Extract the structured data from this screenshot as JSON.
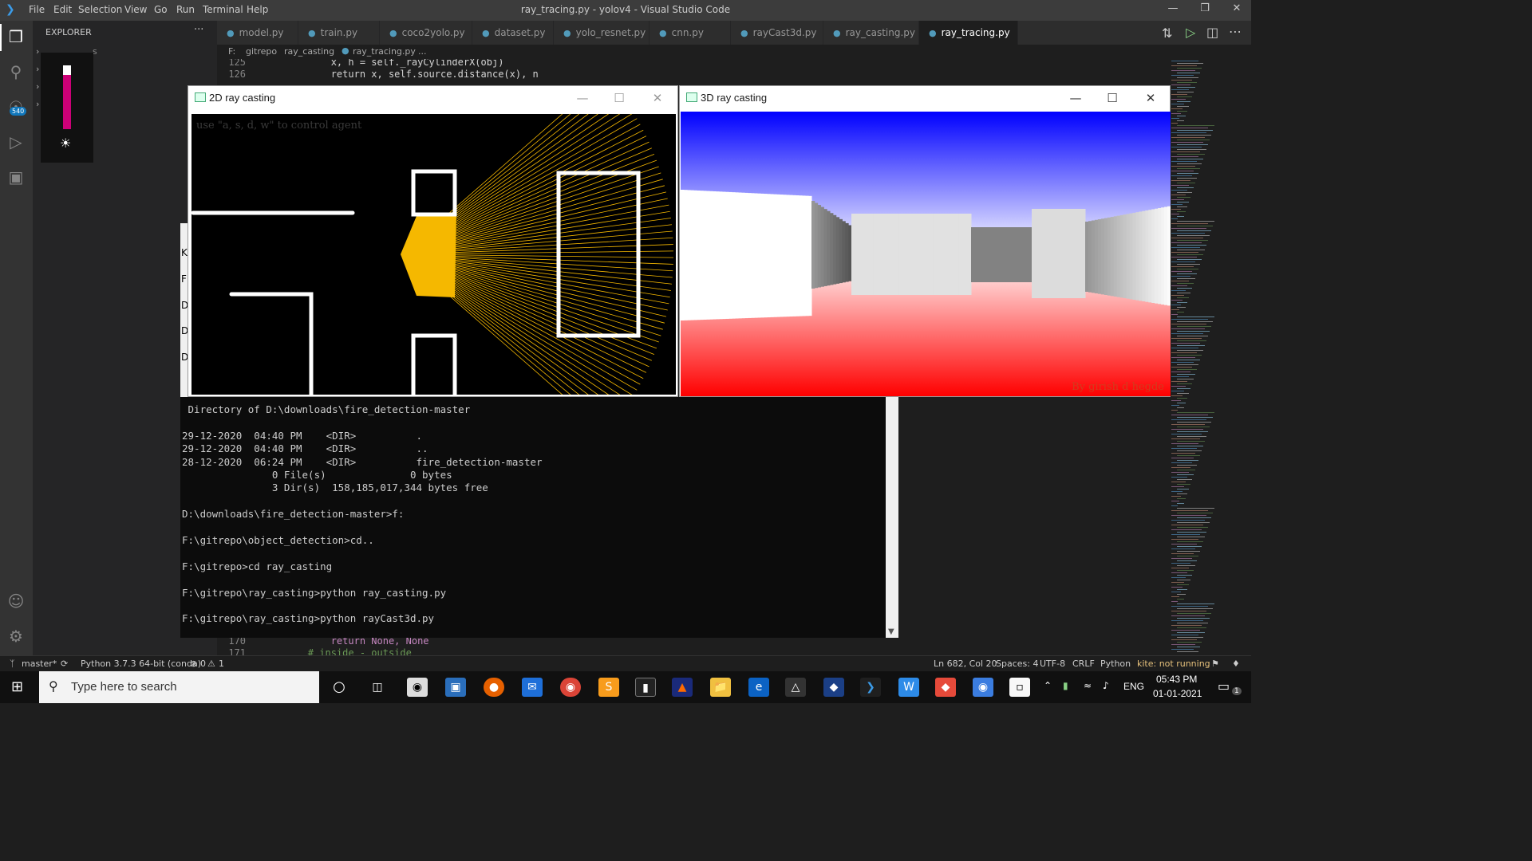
{
  "window": {
    "title": "ray_tracing.py - yolov4 - Visual Studio Code",
    "menu": [
      "File",
      "Edit",
      "Selection",
      "View",
      "Go",
      "Run",
      "Terminal",
      "Help"
    ]
  },
  "activity": {
    "badge": "540"
  },
  "sidebar": {
    "title": "EXPLORER",
    "more": "···",
    "fragment": "s"
  },
  "tabs": [
    {
      "label": "model.py"
    },
    {
      "label": "train.py"
    },
    {
      "label": "coco2yolo.py"
    },
    {
      "label": "dataset.py"
    },
    {
      "label": "yolo_resnet.py"
    },
    {
      "label": "cnn.py"
    },
    {
      "label": "rayCast3d.py"
    },
    {
      "label": "ray_casting.py"
    },
    {
      "label": "ray_tracing.py",
      "active": true
    }
  ],
  "breadcrumb": [
    "F:",
    "gitrepo",
    "ray_casting",
    "ray_tracing.py",
    "..."
  ],
  "code_top": [
    {
      "ln": "125",
      "text": "            x, h = self._rayCylinderX(obj)"
    },
    {
      "ln": "126",
      "text": "            return x, self.source.distance(x), n"
    }
  ],
  "code_bottom": [
    {
      "ln": "170",
      "text": "            return None, None"
    },
    {
      "ln": "171",
      "text": "        # inside - outside"
    }
  ],
  "win2d": {
    "title": "2D ray casting",
    "hint": "use \"a, s, d, w\" to control agent"
  },
  "win3d": {
    "title": "3D ray casting",
    "credit": "By girish d hegde"
  },
  "behind_letters": [
    "K",
    "F",
    "D",
    "D",
    "D"
  ],
  "console": [
    " Directory of D:\\downloads\\fire_detection-master",
    "",
    "29-12-2020  04:40 PM    <DIR>          .",
    "29-12-2020  04:40 PM    <DIR>          ..",
    "28-12-2020  06:24 PM    <DIR>          fire_detection-master",
    "               0 File(s)              0 bytes",
    "               3 Dir(s)  158,185,017,344 bytes free",
    "",
    "D:\\downloads\\fire_detection-master>f:",
    "",
    "F:\\gitrepo\\object_detection>cd..",
    "",
    "F:\\gitrepo>cd ray_casting",
    "",
    "F:\\gitrepo\\ray_casting>python ray_casting.py",
    "",
    "F:\\gitrepo\\ray_casting>python rayCast3d.py"
  ],
  "status": {
    "branch": "master*",
    "python": "Python 3.7.3 64-bit (conda)",
    "errors": "0",
    "warnings": "1",
    "position": "Ln 682, Col 20",
    "spaces": "Spaces: 4",
    "encoding": "UTF-8",
    "eol": "CRLF",
    "language": "Python",
    "kite": "kite: not running"
  },
  "taskbar": {
    "search_placeholder": "Type here to search",
    "lang": "ENG",
    "time": "05:43 PM",
    "date": "01-01-2021",
    "notif": "1"
  },
  "colors": {
    "ray": "#f5b800",
    "sky_top": "#0000ff",
    "floor_bottom": "#ff0000",
    "credit": "#d23c1e"
  }
}
